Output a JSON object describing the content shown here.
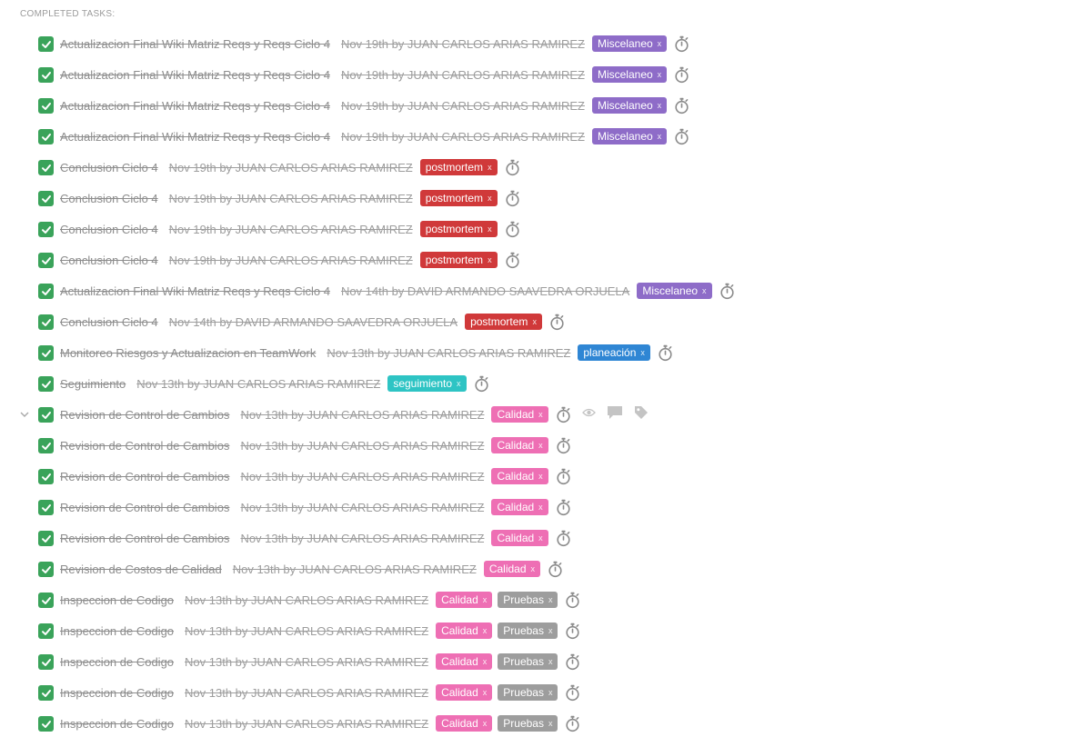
{
  "section": {
    "title": "COMPLETED TASKS:"
  },
  "tag_colors": {
    "Miscelaneo": "#8e6cc8",
    "postmortem": "#d0393a",
    "planeación": "#2f86d4",
    "seguimiento": "#2ec4c4",
    "Calidad": "#ee6fb4",
    "Pruebas": "#9d9d9d"
  },
  "tasks": [
    {
      "title": "Actualizacion Final Wiki Matriz Reqs y Reqs Ciclo 4",
      "meta": "Nov 19th by JUAN CARLOS ARIAS RAMIREZ",
      "tags": [
        {
          "label": "Miscelaneo",
          "x": "x"
        }
      ]
    },
    {
      "title": "Actualizacion Final Wiki Matriz Reqs y Reqs Ciclo 4",
      "meta": "Nov 19th by JUAN CARLOS ARIAS RAMIREZ",
      "tags": [
        {
          "label": "Miscelaneo",
          "x": "x"
        }
      ]
    },
    {
      "title": "Actualizacion Final Wiki Matriz Reqs y Reqs Ciclo 4",
      "meta": "Nov 19th by JUAN CARLOS ARIAS RAMIREZ",
      "tags": [
        {
          "label": "Miscelaneo",
          "x": "x"
        }
      ]
    },
    {
      "title": "Actualizacion Final Wiki Matriz Reqs y Reqs Ciclo 4",
      "meta": "Nov 19th by JUAN CARLOS ARIAS RAMIREZ",
      "tags": [
        {
          "label": "Miscelaneo",
          "x": "x"
        }
      ]
    },
    {
      "title": "Conclusion Ciclo 4",
      "meta": "Nov 19th by JUAN CARLOS ARIAS RAMIREZ",
      "tags": [
        {
          "label": "postmortem",
          "x": "x"
        }
      ]
    },
    {
      "title": "Conclusion Ciclo 4",
      "meta": "Nov 19th by JUAN CARLOS ARIAS RAMIREZ",
      "tags": [
        {
          "label": "postmortem",
          "x": "x"
        }
      ]
    },
    {
      "title": "Conclusion Ciclo 4",
      "meta": "Nov 19th by JUAN CARLOS ARIAS RAMIREZ",
      "tags": [
        {
          "label": "postmortem",
          "x": "x"
        }
      ]
    },
    {
      "title": "Conclusion Ciclo 4",
      "meta": "Nov 19th by JUAN CARLOS ARIAS RAMIREZ",
      "tags": [
        {
          "label": "postmortem",
          "x": "x"
        }
      ]
    },
    {
      "title": "Actualizacion Final Wiki Matriz Reqs y Reqs Ciclo 4",
      "meta": "Nov 14th by DAVID ARMANDO SAAVEDRA ORJUELA",
      "tags": [
        {
          "label": "Miscelaneo",
          "x": "x"
        }
      ]
    },
    {
      "title": "Conclusion Ciclo 4",
      "meta": "Nov 14th by DAVID ARMANDO SAAVEDRA ORJUELA",
      "tags": [
        {
          "label": "postmortem",
          "x": "x"
        }
      ]
    },
    {
      "title": "Monitoreo Riesgos y Actualizacion en TeamWork",
      "meta": "Nov 13th by JUAN CARLOS ARIAS RAMIREZ",
      "tags": [
        {
          "label": "planeación",
          "x": "x"
        }
      ]
    },
    {
      "title": "Seguimiento",
      "meta": "Nov 13th by JUAN CARLOS ARIAS RAMIREZ",
      "tags": [
        {
          "label": "seguimiento",
          "x": "x"
        }
      ]
    },
    {
      "title": "Revision de Control de Cambios",
      "meta": "Nov 13th by JUAN CARLOS ARIAS RAMIREZ",
      "tags": [
        {
          "label": "Calidad",
          "x": "x"
        }
      ],
      "hovered": true
    },
    {
      "title": "Revision de Control de Cambios",
      "meta": "Nov 13th by JUAN CARLOS ARIAS RAMIREZ",
      "tags": [
        {
          "label": "Calidad",
          "x": "x"
        }
      ]
    },
    {
      "title": "Revision de Control de Cambios",
      "meta": "Nov 13th by JUAN CARLOS ARIAS RAMIREZ",
      "tags": [
        {
          "label": "Calidad",
          "x": "x"
        }
      ]
    },
    {
      "title": "Revision de Control de Cambios",
      "meta": "Nov 13th by JUAN CARLOS ARIAS RAMIREZ",
      "tags": [
        {
          "label": "Calidad",
          "x": "x"
        }
      ]
    },
    {
      "title": "Revision de Control de Cambios",
      "meta": "Nov 13th by JUAN CARLOS ARIAS RAMIREZ",
      "tags": [
        {
          "label": "Calidad",
          "x": "x"
        }
      ]
    },
    {
      "title": "Revision de Costos de Calidad",
      "meta": "Nov 13th by JUAN CARLOS ARIAS RAMIREZ",
      "tags": [
        {
          "label": "Calidad",
          "x": "x"
        }
      ]
    },
    {
      "title": "Inspeccion de Codigo",
      "meta": "Nov 13th by JUAN CARLOS ARIAS RAMIREZ",
      "tags": [
        {
          "label": "Calidad",
          "x": "x"
        },
        {
          "label": "Pruebas",
          "x": "x"
        }
      ]
    },
    {
      "title": "Inspeccion de Codigo",
      "meta": "Nov 13th by JUAN CARLOS ARIAS RAMIREZ",
      "tags": [
        {
          "label": "Calidad",
          "x": "x"
        },
        {
          "label": "Pruebas",
          "x": "x"
        }
      ]
    },
    {
      "title": "Inspeccion de Codigo",
      "meta": "Nov 13th by JUAN CARLOS ARIAS RAMIREZ",
      "tags": [
        {
          "label": "Calidad",
          "x": "x"
        },
        {
          "label": "Pruebas",
          "x": "x"
        }
      ]
    },
    {
      "title": "Inspeccion de Codigo",
      "meta": "Nov 13th by JUAN CARLOS ARIAS RAMIREZ",
      "tags": [
        {
          "label": "Calidad",
          "x": "x"
        },
        {
          "label": "Pruebas",
          "x": "x"
        }
      ]
    },
    {
      "title": "Inspeccion de Codigo",
      "meta": "Nov 13th by JUAN CARLOS ARIAS RAMIREZ",
      "tags": [
        {
          "label": "Calidad",
          "x": "x"
        },
        {
          "label": "Pruebas",
          "x": "x"
        }
      ]
    }
  ],
  "icons": {
    "checkbox": "check-icon",
    "timer": "stopwatch-icon",
    "expander": "chevron-down-icon",
    "row_actions": [
      "eye-icon",
      "comment-icon",
      "tag-icon"
    ]
  }
}
